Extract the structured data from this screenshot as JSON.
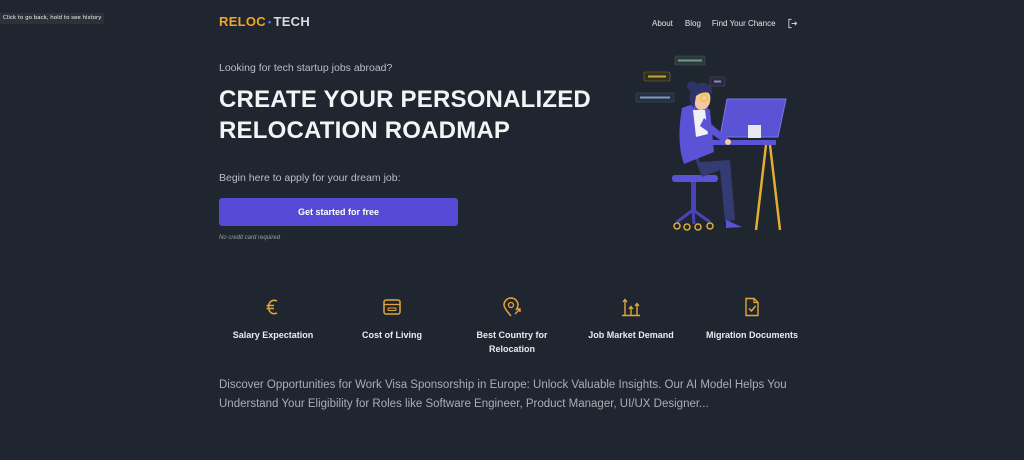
{
  "browser": {
    "back_tooltip": "Click to go back, hold to see history"
  },
  "header": {
    "logo_left": "RELOC",
    "logo_dot": "•",
    "logo_right": "TECH",
    "nav": [
      "About",
      "Blog",
      "Find Your Chance"
    ],
    "logout_icon": "logout-icon"
  },
  "hero": {
    "tagline": "Looking for tech startup jobs abroad?",
    "headline_line1": "CREATE YOUR PERSONALIZED",
    "headline_line2": "RELOCATION ROADMAP",
    "begin_text": "Begin here to apply for your dream job:",
    "cta_label": "Get started for free",
    "no_credit": "No credit card required"
  },
  "features": [
    {
      "label": "Salary Expectation",
      "icon": "euro-icon"
    },
    {
      "label": "Cost of Living",
      "icon": "wallet-icon"
    },
    {
      "label": "Best Country for Relocation",
      "icon": "location-pin-icon"
    },
    {
      "label": "Job Market Demand",
      "icon": "market-chart-icon"
    },
    {
      "label": "Migration Documents",
      "icon": "document-check-icon"
    }
  ],
  "description": "Discover Opportunities for Work Visa Sponsorship in Europe: Unlock Valuable Insights. Our AI Model Helps You Understand Your Eligibility for Roles like Software Engineer, Product Manager, UI/UX Designer...",
  "colors": {
    "background": "#20262f",
    "accent_orange": "#f0a526",
    "accent_purple": "#5549d6"
  }
}
